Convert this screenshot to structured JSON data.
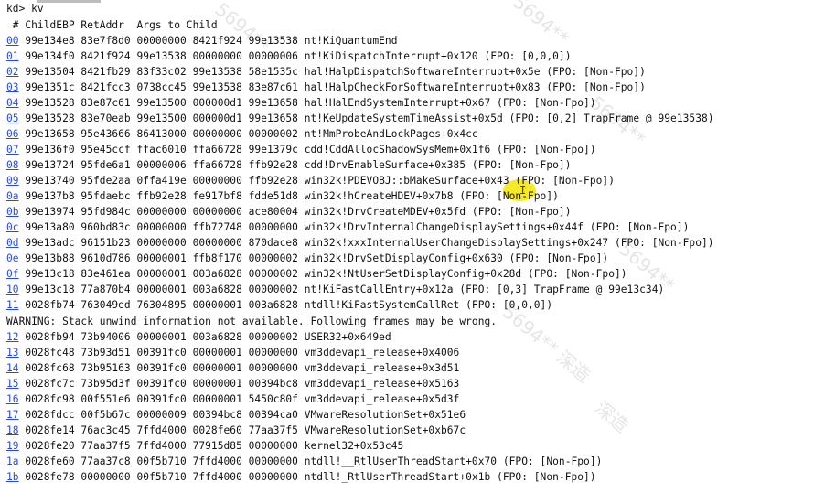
{
  "watermarks": [
    "5694**",
    "5694**",
    "5694**",
    "5694** 深造",
    "深造",
    "5694**"
  ],
  "cursor_glyph": "I",
  "prompt_line": "kd> kv",
  "header_line": " # ChildEBP RetAddr  Args to Child",
  "frames": [
    {
      "num": "00",
      "rest": " 99e134e8 83e7f8d0 00000000 8421f924 99e13538 nt!KiQuantumEnd"
    },
    {
      "num": "01",
      "rest": " 99e134f0 8421f924 99e13538 00000000 00000006 nt!KiDispatchInterrupt+0x120 (FPO: [0,0,0])"
    },
    {
      "num": "02",
      "rest": " 99e13504 8421fb29 83f33c02 99e13538 58e1535c hal!HalpDispatchSoftwareInterrupt+0x5e (FPO: [Non-Fpo])"
    },
    {
      "num": "03",
      "rest": " 99e1351c 8421fcc3 0738cc45 99e13538 83e87c61 hal!HalpCheckForSoftwareInterrupt+0x83 (FPO: [Non-Fpo])"
    },
    {
      "num": "04",
      "rest": " 99e13528 83e87c61 99e13500 000000d1 99e13658 hal!HalEndSystemInterrupt+0x67 (FPO: [Non-Fpo])"
    },
    {
      "num": "05",
      "rest": " 99e13528 83e70eab 99e13500 000000d1 99e13658 nt!KeUpdateSystemTimeAssist+0x5d (FPO: [0,2] TrapFrame @ 99e13538)"
    },
    {
      "num": "06",
      "rest": " 99e13658 95e43666 86413000 00000000 00000002 nt!MmProbeAndLockPages+0x4cc"
    },
    {
      "num": "07",
      "rest": " 99e136f0 95e45ccf ffac6010 ffa66728 99e1379c cdd!CddAllocShadowSysMem+0x1f6 (FPO: [Non-Fpo])"
    },
    {
      "num": "08",
      "rest": " 99e13724 95fde6a1 00000006 ffa66728 ffb92e28 cdd!DrvEnableSurface+0x385 (FPO: [Non-Fpo])"
    },
    {
      "num": "09",
      "rest": " 99e13740 95fde2aa 0ffa419e 00000000 ffb92e28 win32k!PDEVOBJ::bMakeSurface+0x43 (FPO: [Non-Fpo])"
    },
    {
      "num": "0a",
      "rest": " 99e137b8 95fdaebc ffb92e28 fe917bf8 fdde51d8 win32k!hCreateHDEV+0x7b8 (FPO: [Non-Fpo])"
    },
    {
      "num": "0b",
      "rest": " 99e13974 95fd984c 00000000 00000000 ace80004 win32k!DrvCreateMDEV+0x5fd (FPO: [Non-Fpo])"
    },
    {
      "num": "0c",
      "rest": " 99e13a80 960bd83c 00000000 ffb72748 00000000 win32k!DrvInternalChangeDisplaySettings+0x44f (FPO: [Non-Fpo])"
    },
    {
      "num": "0d",
      "rest": " 99e13adc 96151b23 00000000 00000000 870dace8 win32k!xxxInternalUserChangeDisplaySettings+0x247 (FPO: [Non-Fpo])"
    },
    {
      "num": "0e",
      "rest": " 99e13b88 9610d786 00000001 ffb8f170 00000002 win32k!DrvSetDisplayConfig+0x630 (FPO: [Non-Fpo])"
    },
    {
      "num": "0f",
      "rest": " 99e13c18 83e461ea 00000001 003a6828 00000002 win32k!NtUserSetDisplayConfig+0x28d (FPO: [Non-Fpo])"
    },
    {
      "num": "10",
      "rest": " 99e13c18 77a870b4 00000001 003a6828 00000002 nt!KiFastCallEntry+0x12a (FPO: [0,3] TrapFrame @ 99e13c34)"
    },
    {
      "num": "11",
      "rest": " 0028fb74 763049ed 76304895 00000001 003a6828 ntdll!KiFastSystemCallRet (FPO: [0,0,0])"
    }
  ],
  "warning_line": "WARNING: Stack unwind information not available. Following frames may be wrong.",
  "frames2": [
    {
      "num": "12",
      "rest": " 0028fb94 73b94006 00000001 003a6828 00000002 USER32+0x649ed"
    },
    {
      "num": "13",
      "rest": " 0028fc48 73b93d51 00391fc0 00000001 00000000 vm3ddevapi_release+0x4006"
    },
    {
      "num": "14",
      "rest": " 0028fc68 73b95163 00391fc0 00000001 00000000 vm3ddevapi_release+0x3d51"
    },
    {
      "num": "15",
      "rest": " 0028fc7c 73b95d3f 00391fc0 00000001 00394bc8 vm3ddevapi_release+0x5163"
    },
    {
      "num": "16",
      "rest": " 0028fc98 00f551e6 00391fc0 00000001 5450c80f vm3ddevapi_release+0x5d3f"
    },
    {
      "num": "17",
      "rest": " 0028fdcc 00f5b67c 00000009 00394bc8 00394ca0 VMwareResolutionSet+0x51e6"
    },
    {
      "num": "18",
      "rest": " 0028fe14 76ac3c45 7ffd4000 0028fe60 77aa37f5 VMwareResolutionSet+0xb67c"
    },
    {
      "num": "19",
      "rest": " 0028fe20 77aa37f5 7ffd4000 77915d85 00000000 kernel32+0x53c45"
    },
    {
      "num": "1a",
      "rest": " 0028fe60 77aa37c8 00f5b710 7ffd4000 00000000 ntdll!__RtlUserThreadStart+0x70 (FPO: [Non-Fpo])"
    },
    {
      "num": "1b",
      "rest": " 0028fe78 00000000 00f5b710 7ffd4000 00000000 ntdll!_RtlUserThreadStart+0x1b (FPO: [Non-Fpo])"
    }
  ]
}
